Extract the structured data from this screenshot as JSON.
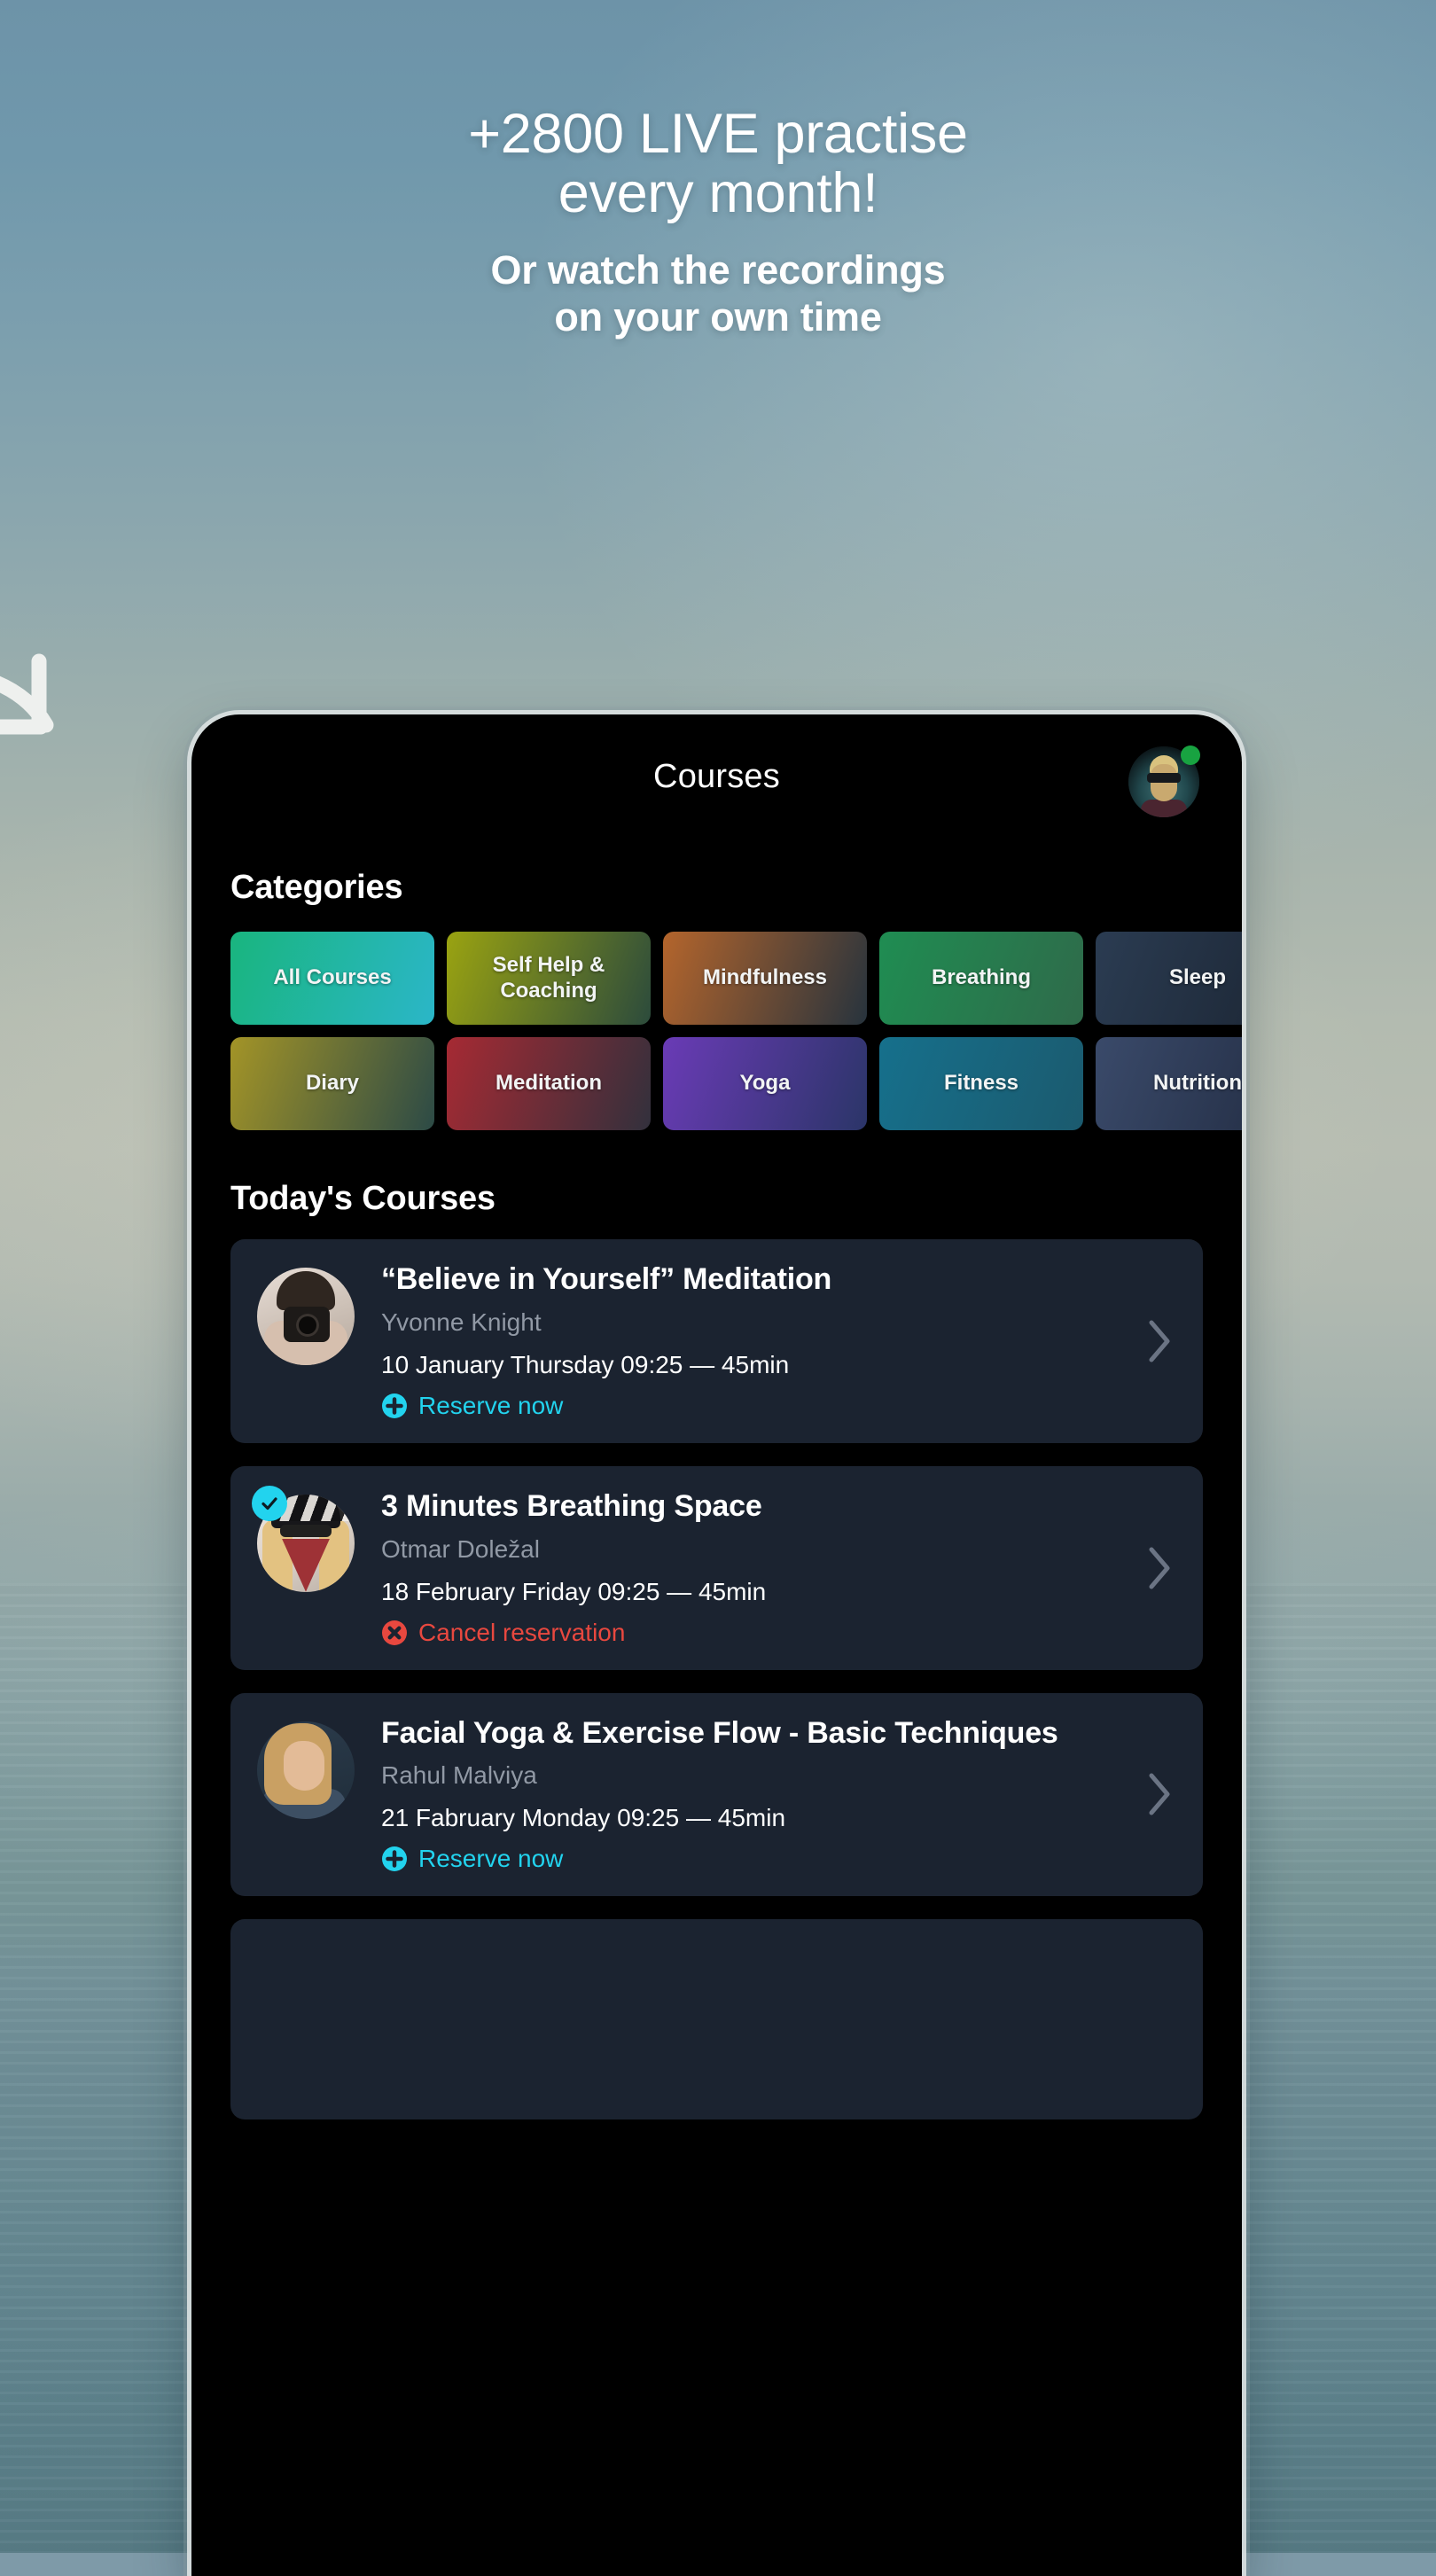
{
  "promo": {
    "headline": "+2800 LIVE practise\never y month!",
    "headline_line1": "+2800 LIVE practise",
    "headline_line2": "every month!",
    "subhead_line1": "Or watch the recordings",
    "subhead_line2": "on your own time"
  },
  "colors": {
    "accent_cyan": "#22d3ee",
    "danger_red": "#e8483f",
    "card_bg": "#1b2330",
    "phone_bg": "#000000",
    "status_green": "#18a341",
    "muted_text": "#9199a5"
  },
  "app": {
    "nav": {
      "title": "Courses",
      "avatar_name": "profile-avatar",
      "status": "online"
    },
    "categories": {
      "section_title": "Categories",
      "items": [
        {
          "label": "All Courses",
          "from": "#19b57e",
          "to": "#2bb6c8",
          "selected": true
        },
        {
          "label": "Self Help &\nCoaching",
          "from": "#9aa311",
          "to": "#2c4b3c",
          "selected": false
        },
        {
          "label": "Mindfulness",
          "from": "#b4652c",
          "to": "#27333d",
          "selected": false
        },
        {
          "label": "Breathing",
          "from": "#1f8d52",
          "to": "#2f6a4a",
          "selected": false
        },
        {
          "label": "Sleep",
          "from": "#2b3c52",
          "to": "#1b2533",
          "selected": false
        },
        {
          "label": "Diary",
          "from": "#a39427",
          "to": "#2c4a46",
          "selected": false
        },
        {
          "label": "Meditation",
          "from": "#a62a33",
          "to": "#32303c",
          "selected": false
        },
        {
          "label": "Yoga",
          "from": "#6a3bb6",
          "to": "#2b3568",
          "selected": false
        },
        {
          "label": "Fitness",
          "from": "#16708c",
          "to": "#1b5a6e",
          "selected": false
        },
        {
          "label": "Nutrition",
          "from": "#3a4a6a",
          "to": "#222c42",
          "selected": false
        }
      ]
    },
    "today": {
      "section_title": "Today's Courses",
      "courses": [
        {
          "title": "“Believe in Yourself” Meditation",
          "instructor": "Yvonne Knight",
          "schedule": "10 January Thursday 09:25 — 45min",
          "action_label": "Reserve now",
          "action_type": "reserve",
          "reserved": false
        },
        {
          "title": "3 Minutes Breathing Space",
          "instructor": "Otmar Doležal",
          "schedule": "18 February Friday 09:25 — 45min",
          "action_label": "Cancel reservation",
          "action_type": "cancel",
          "reserved": true
        },
        {
          "title": "Facial Yoga & Exercise Flow - Basic Techniques",
          "instructor": "Rahul Malviya",
          "schedule": "21 Fabruary Monday 09:25 — 45min",
          "action_label": "Reserve now",
          "action_type": "reserve",
          "reserved": false
        }
      ]
    }
  }
}
